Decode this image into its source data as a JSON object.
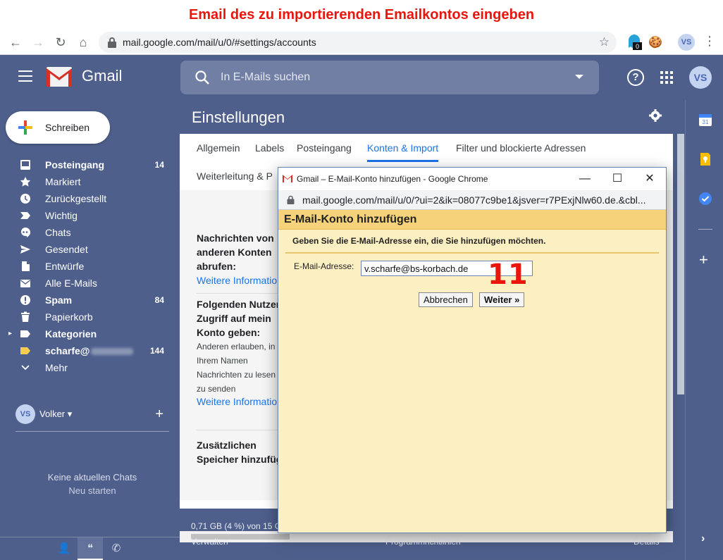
{
  "caption": "Email des zu importierenden Emailkontos eingeben",
  "browser": {
    "url": "mail.google.com/mail/u/0/#settings/accounts",
    "ext_badge": "0",
    "avatar": "VS"
  },
  "header": {
    "app_name": "Gmail",
    "search_placeholder": "In E-Mails suchen",
    "avatar": "VS"
  },
  "sidebar": {
    "compose_label": "Schreiben",
    "items": [
      {
        "label": "Posteingang",
        "count": "14",
        "icon": "inbox-icon",
        "bold": true
      },
      {
        "label": "Markiert",
        "count": "",
        "icon": "star-icon"
      },
      {
        "label": "Zurückgestellt",
        "count": "",
        "icon": "clock-icon"
      },
      {
        "label": "Wichtig",
        "count": "",
        "icon": "important-icon"
      },
      {
        "label": "Chats",
        "count": "",
        "icon": "chat-icon"
      },
      {
        "label": "Gesendet",
        "count": "",
        "icon": "send-icon"
      },
      {
        "label": "Entwürfe",
        "count": "",
        "icon": "draft-icon"
      },
      {
        "label": "Alle E-Mails",
        "count": "",
        "icon": "mail-icon"
      },
      {
        "label": "Spam",
        "count": "84",
        "icon": "spam-icon",
        "bold": true
      },
      {
        "label": "Papierkorb",
        "count": "",
        "icon": "trash-icon"
      },
      {
        "label": "Kategorien",
        "count": "",
        "icon": "label-icon",
        "bold": true
      },
      {
        "label": "scharfe@",
        "count": "144",
        "icon": "label-yellow-icon",
        "bold": true
      },
      {
        "label": "Mehr",
        "count": "",
        "icon": "chevron-down-icon"
      }
    ],
    "hangouts_user": "Volker",
    "hangouts_user_initials": "VS",
    "no_chats": "Keine aktuellen Chats",
    "new_start": "Neu starten"
  },
  "settings": {
    "title": "Einstellungen",
    "tabs": [
      "Allgemein",
      "Labels",
      "Posteingang",
      "Konten & Import",
      "Filter und blockierte Adressen"
    ],
    "active_tab": "Konten & Import",
    "tab_row2": "Weiterleitung & P",
    "sections": {
      "fetch_title_1": "Nachrichten von",
      "fetch_title_2": "anderen Konten",
      "fetch_title_3": "abrufen:",
      "fetch_link": "Weitere Information",
      "grant_title_1": "Folgenden Nutzer",
      "grant_title_2": "Zugriff auf mein",
      "grant_title_3": "Konto geben:",
      "grant_text_1": "Anderen erlauben, in",
      "grant_text_2": "Ihrem Namen",
      "grant_text_3": "Nachrichten zu lesen",
      "grant_text_4": "zu senden",
      "grant_link": "Weitere Information",
      "storage_title_1": "Zusätzlichen",
      "storage_title_2": "Speicher hinzufüg"
    },
    "storage_info": "0,71 GB (4 %) von 15 G",
    "footer": {
      "manage": "Verwalten",
      "policies": "Programmrichtlinien",
      "details": "Details"
    }
  },
  "popup": {
    "window_title": "Gmail – E-Mail-Konto hinzufügen - Google Chrome",
    "url": "mail.google.com/mail/u/0/?ui=2&ik=08077c9be1&jsver=r7PExjNlw60.de.&cbl...",
    "heading": "E-Mail-Konto hinzufügen",
    "instruction": "Geben Sie die E-Mail-Adresse ein, die Sie hinzufügen möchten.",
    "email_label": "E-Mail-Adresse:",
    "email_value": "v.scharfe@bs-korbach.de",
    "step_number": "11",
    "cancel_label": "Abbrechen",
    "next_label": "Weiter »"
  }
}
